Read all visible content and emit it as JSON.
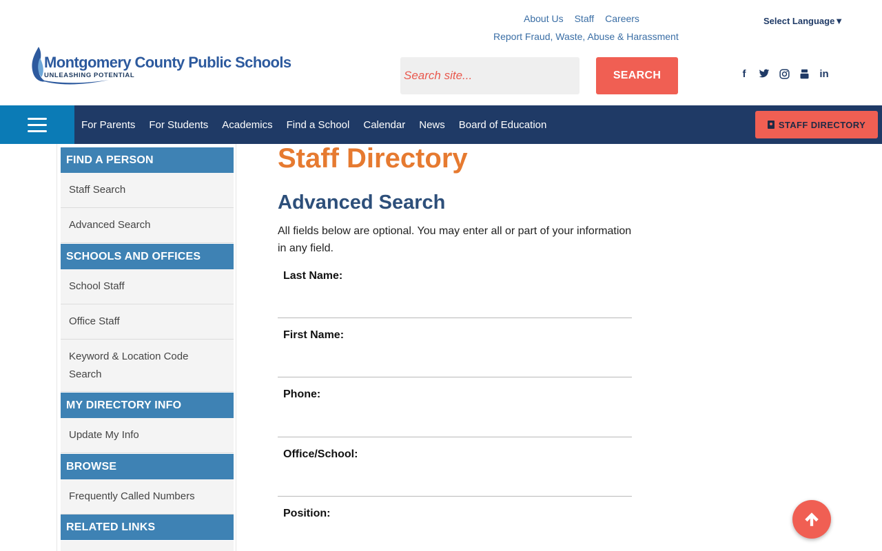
{
  "header": {
    "logo": {
      "title": "Montgomery County Public Schools",
      "tagline": "UNLEASHING POTENTIAL"
    },
    "util_links": [
      "About Us",
      "Staff",
      "Careers"
    ],
    "fraud_link": "Report Fraud, Waste, Abuse & Harassment",
    "language": "Select Language▼",
    "search": {
      "placeholder": "Search site...",
      "button_label": "SEARCH"
    },
    "social_icons": [
      "facebook-icon",
      "twitter-icon",
      "instagram-icon",
      "youtube-icon",
      "linkedin-icon"
    ],
    "social_glyphs": [
      "f",
      "🐦",
      "◎",
      "▶",
      "in"
    ]
  },
  "nav": {
    "items": [
      "For Parents",
      "For Students",
      "Academics",
      "Find a School",
      "Calendar",
      "News",
      "Board of Education"
    ],
    "staff_directory_label": "STAFF DIRECTORY"
  },
  "sidebar": {
    "sections": [
      {
        "heading": "FIND A PERSON",
        "items": [
          "Staff Search",
          "Advanced Search"
        ]
      },
      {
        "heading": "SCHOOLS AND OFFICES",
        "items": [
          "School Staff",
          "Office Staff",
          "Keyword & Location Code Search"
        ]
      },
      {
        "heading": "MY DIRECTORY INFO",
        "items": [
          "Update My Info"
        ]
      },
      {
        "heading": "BROWSE",
        "items": [
          "Frequently Called Numbers"
        ]
      },
      {
        "heading": "RELATED LINKS",
        "items": []
      }
    ]
  },
  "main": {
    "page_title": "Staff Directory",
    "section_title": "Advanced Search",
    "intro": "All fields below are optional. You may enter all or part of your information in any field.",
    "fields": [
      {
        "label": "Last Name:",
        "value": ""
      },
      {
        "label": "First Name:",
        "value": ""
      },
      {
        "label": "Phone:",
        "value": ""
      },
      {
        "label": "Office/School:",
        "value": ""
      },
      {
        "label": "Position:",
        "value": ""
      }
    ]
  },
  "colors": {
    "nav_bg": "#1f3a66",
    "hamburger_bg": "#0b7bb6",
    "accent": "#f05f53",
    "sidebar_heading": "#3e82b4",
    "page_title": "#e67a30",
    "section_title": "#2d4f7a"
  }
}
